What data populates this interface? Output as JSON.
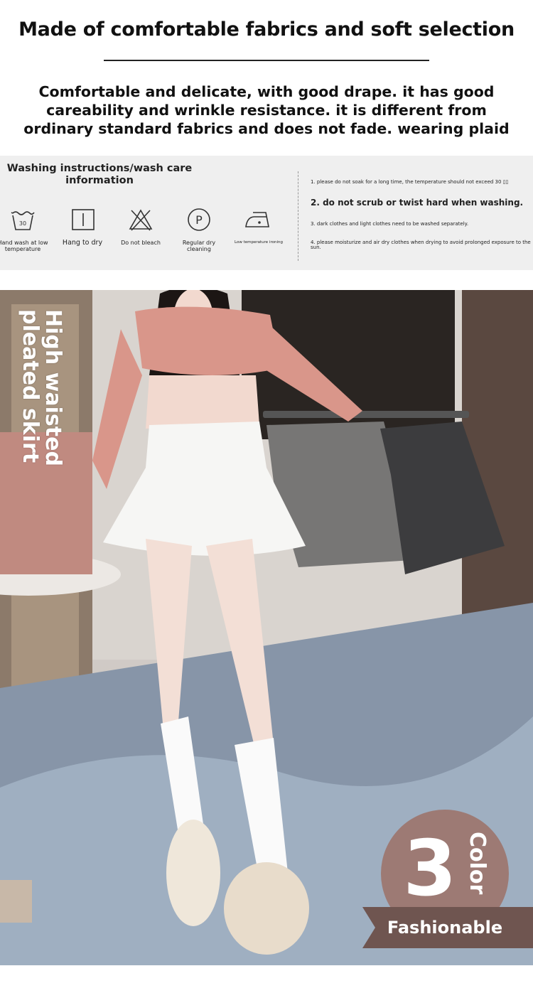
{
  "header": {
    "title": "Made of comfortable fabrics and soft selection",
    "description": [
      "Comfortable and delicate, with good drape. it has good",
      "careability and wrinkle resistance. it is different from",
      "ordinary standard fabrics and does not fade. wearing plaid"
    ]
  },
  "care": {
    "title_line1": "Washing instructions/wash care",
    "title_line2": "information",
    "icons": [
      {
        "icon": "hand-wash-icon",
        "number": "30",
        "label_line1": "Hand wash at low",
        "label_line2": "temperature"
      },
      {
        "icon": "hang-dry-icon",
        "label_line1": "Hang to dry",
        "label_line2": ""
      },
      {
        "icon": "no-bleach-icon",
        "label_line1": "Do not bleach",
        "label_line2": ""
      },
      {
        "icon": "dry-clean-icon",
        "letter": "P",
        "label_line1": "Regular dry",
        "label_line2": "cleaning"
      },
      {
        "icon": "iron-low-icon",
        "label_line1": "Low temperature ironing",
        "label_line2": ""
      }
    ],
    "instructions": [
      "1. please do not soak for a long time, the temperature should not exceed 30 ▯▯",
      "2. do not scrub or twist hard when washing.",
      "3. dark clothes and light clothes need to be washed separately.",
      "4. please moisturize and air dry clothes when drying to avoid prolonged exposure to the",
      "sun."
    ]
  },
  "photo": {
    "caption": "High waisted pleated skirt",
    "badge_number": "3",
    "badge_word": "Color",
    "ribbon_text": "Fashionable"
  },
  "colors": {
    "badge": "#9d7a74",
    "ribbon": "#6f5550",
    "care_bg": "#efefef"
  }
}
